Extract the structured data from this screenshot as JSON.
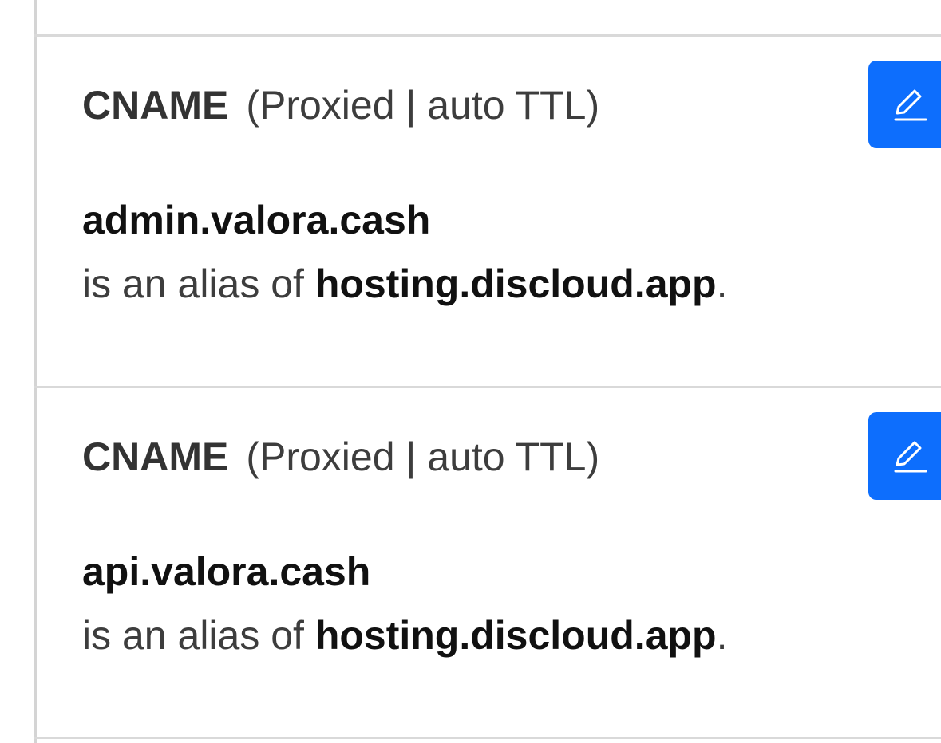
{
  "records": [
    {
      "type": "CNAME",
      "meta": "(Proxied | auto TTL)",
      "name": "admin.valora.cash",
      "alias_prefix": "is an alias of ",
      "target": "hosting.discloud.app",
      "suffix": ".",
      "edit_icon": "pencil-icon"
    },
    {
      "type": "CNAME",
      "meta": "(Proxied | auto TTL)",
      "name": "api.valora.cash",
      "alias_prefix": "is an alias of ",
      "target": "hosting.discloud.app",
      "suffix": ".",
      "edit_icon": "pencil-icon"
    }
  ],
  "colors": {
    "accent": "#0d6efd",
    "divider": "#d9d9d9"
  }
}
